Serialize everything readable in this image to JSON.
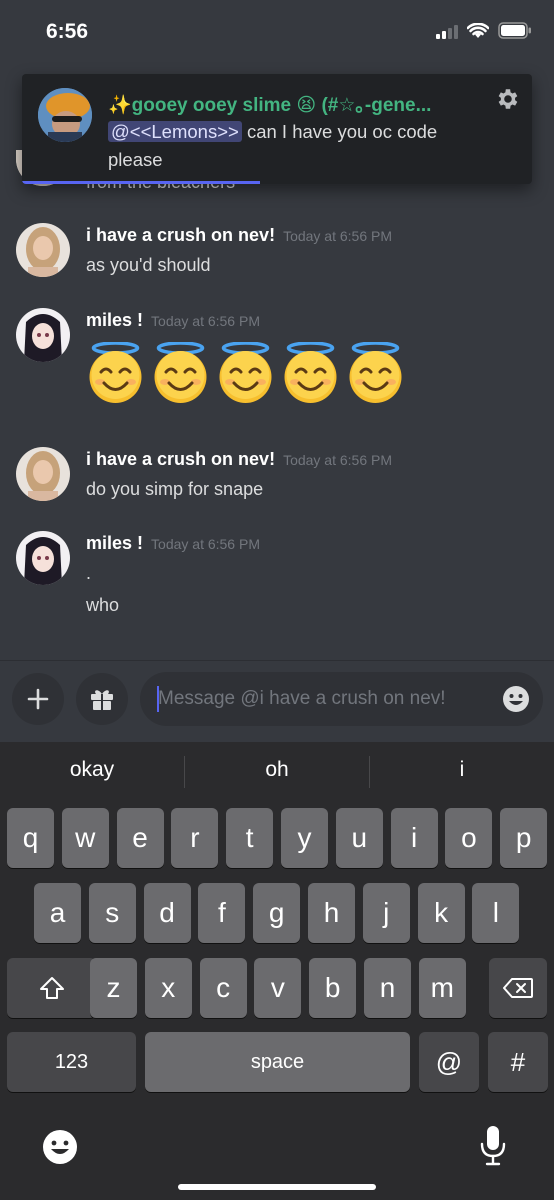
{
  "status_bar": {
    "time": "6:56"
  },
  "notification": {
    "title": "✨gooey ooey slime 😫 (#☆｡-gene...",
    "mention": "@<<Lemons>>",
    "body": "can I have you oc code please",
    "icons": {
      "settings": "gear-icon"
    }
  },
  "messages": {
    "peek_text": "from the bleachers",
    "items": [
      {
        "author": "i have a crush on nev!",
        "timestamp": "Today at 6:56 PM",
        "text": "as you'd should"
      },
      {
        "author": "miles !",
        "timestamp": "Today at 6:56 PM",
        "emoji_count": 5,
        "emoji_name": "smiling-face-with-halo"
      },
      {
        "author": "i have a crush on nev!",
        "timestamp": "Today at 6:56 PM",
        "text": "do you simp for snape"
      },
      {
        "author": "miles !",
        "timestamp": "Today at 6:56 PM",
        "text": ".",
        "text2": "who"
      }
    ]
  },
  "composer": {
    "placeholder": "Message @i have a crush on nev!",
    "icons": {
      "add": "plus-icon",
      "gift": "gift-icon",
      "emoji": "emoji-icon"
    }
  },
  "keyboard": {
    "suggestions": [
      "okay",
      "oh",
      "i"
    ],
    "row1": [
      "q",
      "w",
      "e",
      "r",
      "t",
      "y",
      "u",
      "i",
      "o",
      "p"
    ],
    "row2": [
      "a",
      "s",
      "d",
      "f",
      "g",
      "h",
      "j",
      "k",
      "l"
    ],
    "row3": [
      "z",
      "x",
      "c",
      "v",
      "b",
      "n",
      "m"
    ],
    "numbers_key": "123",
    "space_key": "space",
    "at_key": "@",
    "hash_key": "#"
  },
  "colors": {
    "background": "#36393f",
    "accent": "#5865f2",
    "notification_title": "#43b581"
  }
}
